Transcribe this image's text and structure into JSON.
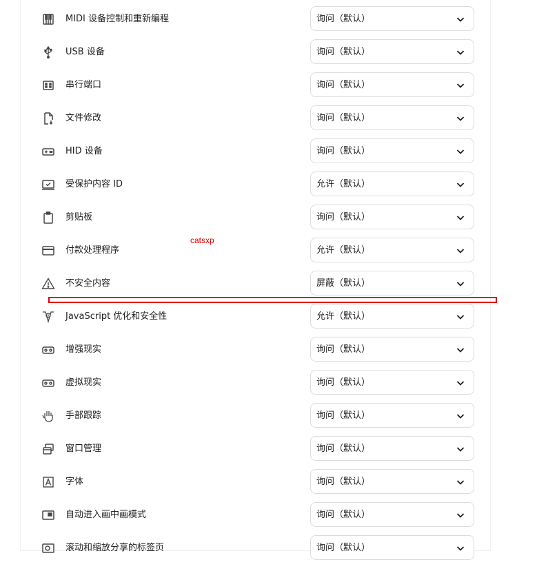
{
  "permissions": [
    {
      "icon": "midi-keyboard-icon",
      "label": "MIDI 设备控制和重新编程",
      "value": "询问（默认）"
    },
    {
      "icon": "usb-icon",
      "label": "USB 设备",
      "value": "询问（默认）"
    },
    {
      "icon": "serial-port-icon",
      "label": "串行端口",
      "value": "询问（默认）"
    },
    {
      "icon": "file-edit-icon",
      "label": "文件修改",
      "value": "询问（默认）"
    },
    {
      "icon": "gamepad-icon",
      "label": "HID 设备",
      "value": "询问（默认）"
    },
    {
      "icon": "protected-content-icon",
      "label": "受保护内容 ID",
      "value": "允许（默认）"
    },
    {
      "icon": "clipboard-icon",
      "label": "剪贴板",
      "value": "询问（默认）"
    },
    {
      "icon": "payment-card-icon",
      "label": "付款处理程序",
      "value": "允许（默认）"
    },
    {
      "icon": "warning-icon",
      "label": "不安全内容",
      "value": "屏蔽（默认）"
    },
    {
      "icon": "v8-javascript-icon",
      "label": "JavaScript 优化和安全性",
      "value": "允许（默认）"
    },
    {
      "icon": "vr-headset-ar-icon",
      "label": "增强现实",
      "value": "询问（默认）"
    },
    {
      "icon": "vr-headset-icon",
      "label": "虚拟现实",
      "value": "询问（默认）"
    },
    {
      "icon": "hand-tracking-icon",
      "label": "手部跟踪",
      "value": "询问（默认）"
    },
    {
      "icon": "window-management-icon",
      "label": "窗口管理",
      "value": "询问（默认）"
    },
    {
      "icon": "font-icon",
      "label": "字体",
      "value": "询问（默认）"
    },
    {
      "icon": "picture-in-picture-icon",
      "label": "自动进入画中画模式",
      "value": "询问（默认）"
    },
    {
      "icon": "scroll-zoom-icon",
      "label": "滚动和缩放分享的标签页",
      "value": "询问（默认）"
    }
  ],
  "watermark": "catsxp",
  "colors": {
    "annotation": "#e00000",
    "border": "#dadce0",
    "icon": "#474747"
  }
}
